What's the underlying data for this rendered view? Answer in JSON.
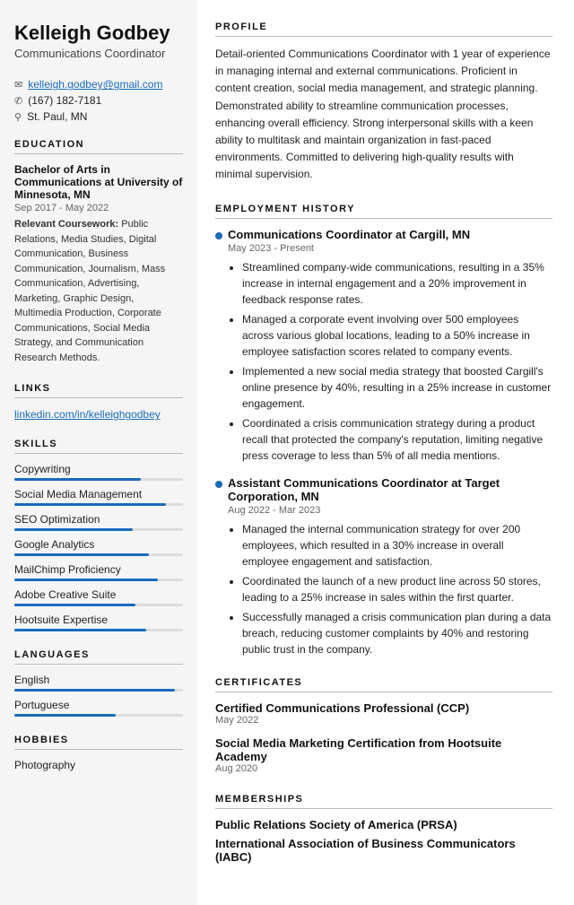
{
  "sidebar": {
    "name": "Kelleigh Godbey",
    "title": "Communications Coordinator",
    "contact": {
      "email": "kelleigh.godbey@gmail.com",
      "phone": "(167) 182-7181",
      "location": "St. Paul, MN"
    },
    "education_section_label": "EDUCATION",
    "education": {
      "degree": "Bachelor of Arts in Communications at University of Minnesota, MN",
      "dates": "Sep 2017 - May 2022",
      "coursework_label": "Relevant Coursework:",
      "coursework": "Public Relations, Media Studies, Digital Communication, Business Communication, Journalism, Mass Communication, Advertising, Marketing, Graphic Design, Multimedia Production, Corporate Communications, Social Media Strategy, and Communication Research Methods."
    },
    "links_section_label": "LINKS",
    "links": [
      {
        "label": "linkedin.com/in/kelleighgodbey",
        "url": "linkedin.com/in/kelleighgodbey"
      }
    ],
    "skills_section_label": "SKILLS",
    "skills": [
      {
        "name": "Copywriting",
        "pct": 75
      },
      {
        "name": "Social Media Management",
        "pct": 90
      },
      {
        "name": "SEO Optimization",
        "pct": 70
      },
      {
        "name": "Google Analytics",
        "pct": 80
      },
      {
        "name": "MailChimp Proficiency",
        "pct": 85
      },
      {
        "name": "Adobe Creative Suite",
        "pct": 72
      },
      {
        "name": "Hootsuite Expertise",
        "pct": 78
      }
    ],
    "languages_section_label": "LANGUAGES",
    "languages": [
      {
        "name": "English",
        "pct": 95
      },
      {
        "name": "Portuguese",
        "pct": 60
      }
    ],
    "hobbies_section_label": "HOBBIES",
    "hobbies": [
      {
        "name": "Photography"
      }
    ]
  },
  "main": {
    "profile_section_label": "PROFILE",
    "profile_text": "Detail-oriented Communications Coordinator with 1 year of experience in managing internal and external communications. Proficient in content creation, social media management, and strategic planning. Demonstrated ability to streamline communication processes, enhancing overall efficiency. Strong interpersonal skills with a keen ability to multitask and maintain organization in fast-paced environments. Committed to delivering high-quality results with minimal supervision.",
    "employment_section_label": "EMPLOYMENT HISTORY",
    "jobs": [
      {
        "title": "Communications Coordinator at Cargill, MN",
        "dates": "May 2023 - Present",
        "bullets": [
          "Streamlined company-wide communications, resulting in a 35% increase in internal engagement and a 20% improvement in feedback response rates.",
          "Managed a corporate event involving over 500 employees across various global locations, leading to a 50% increase in employee satisfaction scores related to company events.",
          "Implemented a new social media strategy that boosted Cargill's online presence by 40%, resulting in a 25% increase in customer engagement.",
          "Coordinated a crisis communication strategy during a product recall that protected the company's reputation, limiting negative press coverage to less than 5% of all media mentions."
        ]
      },
      {
        "title": "Assistant Communications Coordinator at Target Corporation, MN",
        "dates": "Aug 2022 - Mar 2023",
        "bullets": [
          "Managed the internal communication strategy for over 200 employees, which resulted in a 30% increase in overall employee engagement and satisfaction.",
          "Coordinated the launch of a new product line across 50 stores, leading to a 25% increase in sales within the first quarter.",
          "Successfully managed a crisis communication plan during a data breach, reducing customer complaints by 40% and restoring public trust in the company."
        ]
      }
    ],
    "certificates_section_label": "CERTIFICATES",
    "certificates": [
      {
        "name": "Certified Communications Professional (CCP)",
        "date": "May 2022"
      },
      {
        "name": "Social Media Marketing Certification from Hootsuite Academy",
        "date": "Aug 2020"
      }
    ],
    "memberships_section_label": "MEMBERSHIPS",
    "memberships": [
      {
        "name": "Public Relations Society of America (PRSA)"
      },
      {
        "name": "International Association of Business Communicators (IABC)"
      }
    ]
  }
}
